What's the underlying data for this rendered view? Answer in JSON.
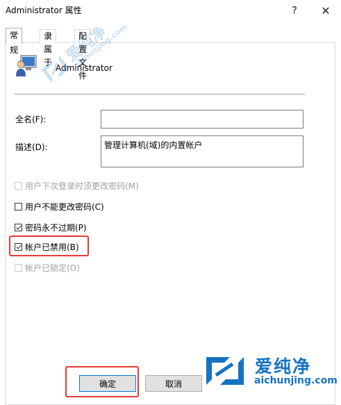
{
  "window": {
    "title": "Administrator 属性",
    "help_glyph": "?",
    "close_glyph": "✕"
  },
  "tabs": [
    {
      "label": "常规",
      "active": true
    },
    {
      "label": "隶属于",
      "active": false
    },
    {
      "label": "配置文件",
      "active": false
    }
  ],
  "user": {
    "name": "Administrator",
    "icon": "user-monitor-icon"
  },
  "fields": {
    "fullname": {
      "label": "全名(F):",
      "value": ""
    },
    "description": {
      "label": "描述(D):",
      "value": "管理计算机(域)的内置帐户"
    }
  },
  "options": [
    {
      "label": "用户下次登录时须更改密码(M)",
      "checked": false,
      "disabled": true
    },
    {
      "label": "用户不能更改密码(C)",
      "checked": false,
      "disabled": false
    },
    {
      "label": "密码永不过期(P)",
      "checked": true,
      "disabled": false
    },
    {
      "label": "帐户已禁用(B)",
      "checked": true,
      "disabled": false
    },
    {
      "label": "帐户已锁定(O)",
      "checked": false,
      "disabled": true
    }
  ],
  "buttons": {
    "ok_label": "确定",
    "cancel_label": "取消"
  },
  "watermark": {
    "text_cn": "爱纯净",
    "text_en": "aichunjing.com"
  },
  "colors": {
    "highlight": "#e53935",
    "brand": "#1573c1",
    "focus": "#0078d7"
  }
}
